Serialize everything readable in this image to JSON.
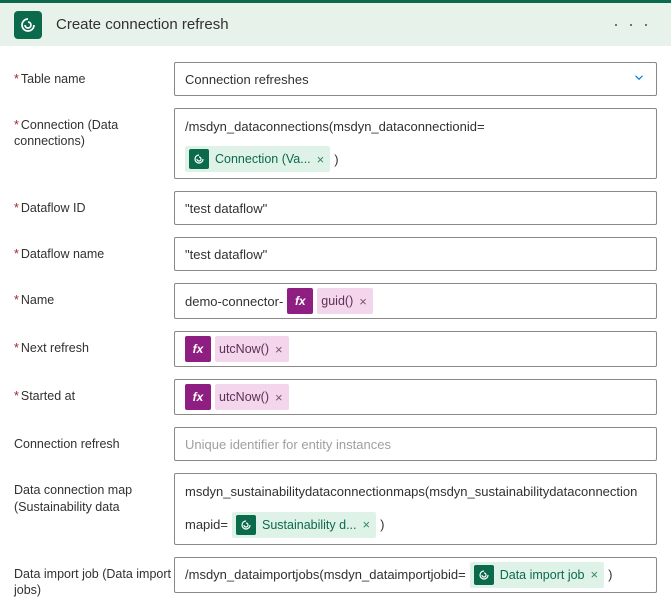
{
  "header": {
    "title": "Create connection refresh"
  },
  "fields": {
    "table_name": {
      "label": "Table name",
      "value": "Connection refreshes"
    },
    "connection": {
      "label": "Connection (Data connections)",
      "prefix": "/msdyn_dataconnections(msdyn_dataconnectionid=",
      "token_label": "Connection (Va...",
      "suffix": ")"
    },
    "dataflow_id": {
      "label": "Dataflow ID",
      "value": "\"test dataflow\""
    },
    "dataflow_name": {
      "label": "Dataflow name",
      "value": "\"test dataflow\""
    },
    "name": {
      "label": "Name",
      "prefix": "demo-connector-",
      "fx_label": "guid()"
    },
    "next_refresh": {
      "label": "Next refresh",
      "fx_label": "utcNow()"
    },
    "started_at": {
      "label": "Started at",
      "fx_label": "utcNow()"
    },
    "connection_refresh": {
      "label": "Connection refresh",
      "placeholder": "Unique identifier for entity instances"
    },
    "data_connection_map": {
      "label": "Data connection map (Sustainability data",
      "line1": "msdyn_sustainabilitydataconnectionmaps(msdyn_sustainabilitydataconnection",
      "line2_prefix": "mapid=",
      "token_label": "Sustainability d...",
      "suffix": ")"
    },
    "data_import_job": {
      "label": "Data import job (Data import jobs)",
      "prefix": "/msdyn_dataimportjobs(msdyn_dataimportjobid=",
      "token_label": "Data import job",
      "suffix": ")"
    }
  },
  "glyphs": {
    "fx": "fx",
    "close": "×",
    "ellipsis": "· · ·"
  }
}
